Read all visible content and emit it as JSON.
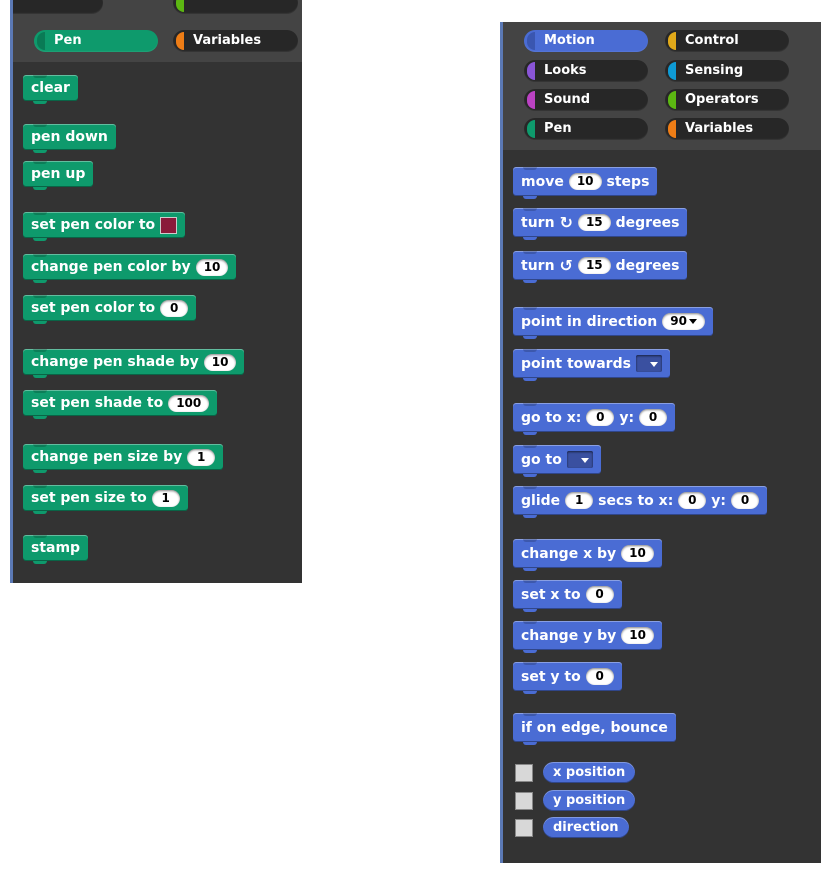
{
  "colors": {
    "pen": "#0e9a6c",
    "motion": "#4a6cd4",
    "looks": "#8a55d7",
    "sound": "#bb42c3",
    "control": "#e1a91a",
    "sensing": "#0e9ad4",
    "operators": "#5cb712",
    "variables": "#ee7d16",
    "panel_bg": "#333333"
  },
  "left_palette": {
    "categories": [
      {
        "label": "Pen",
        "selected": true
      },
      {
        "label": "Variables",
        "selected": false
      }
    ],
    "blocks": {
      "clear": "clear",
      "pen_down": "pen down",
      "pen_up": "pen up",
      "set_pen_color_to_color": "set pen color to",
      "change_pen_color_by": "change pen color by",
      "change_pen_color_by_value": "10",
      "set_pen_color_to_num": "set pen color to",
      "set_pen_color_to_num_value": "0",
      "change_pen_shade_by": "change pen shade by",
      "change_pen_shade_by_value": "10",
      "set_pen_shade_to": "set pen shade to",
      "set_pen_shade_to_value": "100",
      "change_pen_size_by": "change pen size by",
      "change_pen_size_by_value": "1",
      "set_pen_size_to": "set pen size to",
      "set_pen_size_to_value": "1",
      "stamp": "stamp"
    }
  },
  "right_palette": {
    "categories": {
      "motion": "Motion",
      "control": "Control",
      "looks": "Looks",
      "sensing": "Sensing",
      "sound": "Sound",
      "operators": "Operators",
      "pen": "Pen",
      "variables": "Variables"
    },
    "blocks": {
      "move": "move",
      "move_value": "10",
      "steps": "steps",
      "turn": "turn",
      "turn_cw_value": "15",
      "turn_ccw_value": "15",
      "degrees": "degrees",
      "point_in_direction": "point in direction",
      "point_in_direction_value": "90",
      "point_towards": "point towards",
      "go_to_x": "go to x:",
      "go_to_x_value": "0",
      "y": "y:",
      "go_to_y_value": "0",
      "go_to": "go to",
      "glide": "glide",
      "glide_secs_value": "1",
      "secs_to_x": "secs to x:",
      "glide_x_value": "0",
      "glide_y_value": "0",
      "change_x_by": "change x by",
      "change_x_by_value": "10",
      "set_x_to": "set x to",
      "set_x_to_value": "0",
      "change_y_by": "change y by",
      "change_y_by_value": "10",
      "set_y_to": "set y to",
      "set_y_to_value": "0",
      "if_on_edge_bounce": "if on edge, bounce"
    },
    "reporters": {
      "x_position": "x position",
      "y_position": "y position",
      "direction": "direction"
    }
  }
}
